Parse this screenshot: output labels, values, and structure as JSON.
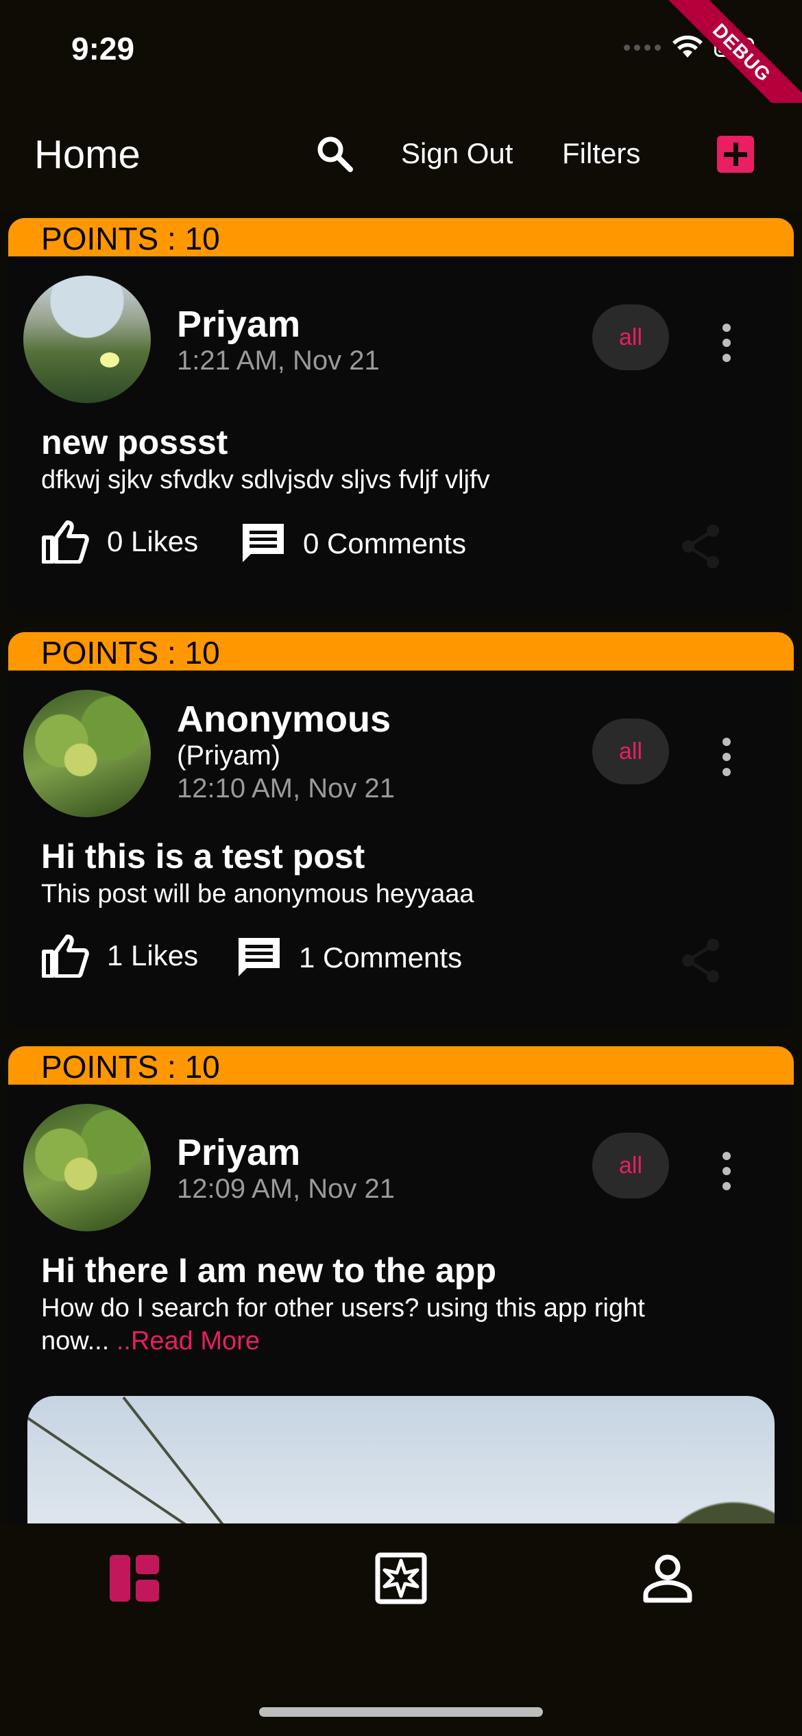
{
  "status_bar": {
    "time": "9:29",
    "debug_label": "DEBUG"
  },
  "app_bar": {
    "title": "Home",
    "sign_out_label": "Sign Out",
    "filters_label": "Filters",
    "icons": [
      "search-icon",
      "add-icon"
    ]
  },
  "colors": {
    "accent": "#e91e63",
    "points_banner": "#ff9800",
    "background": "#0d0b05",
    "card": "#0a0a0a"
  },
  "posts": [
    {
      "points": "POINTS : 10",
      "user_name": "Priyam",
      "user_sub": "",
      "time": "1:21 AM,  Nov 21",
      "chip": "all",
      "title": "new possst",
      "body": "dfkwj sjkv sfvdkv sdlvjsdv sljvs fvljf vljfv",
      "read_more": "",
      "likes": "0 Likes",
      "comments": "0 Comments"
    },
    {
      "points": "POINTS : 10",
      "user_name": "Anonymous",
      "user_sub": "(Priyam)",
      "time": "12:10 AM,  Nov 21",
      "chip": "all",
      "title": "Hi this is a test post",
      "body": "This post will be anonymous heyyaaa",
      "read_more": "",
      "likes": "1 Likes",
      "comments": "1 Comments"
    },
    {
      "points": "POINTS : 10",
      "user_name": "Priyam",
      "user_sub": "",
      "time": "12:09 AM,  Nov 21",
      "chip": "all",
      "title": "Hi there I am new to the app",
      "body": "How do I search for other users? using this app right now...",
      "read_more": " ..Read More",
      "likes": "",
      "comments": ""
    }
  ],
  "bottom_nav": {
    "items": [
      "dashboard-icon",
      "explore-icon",
      "profile-icon"
    ],
    "active": "dashboard-icon"
  }
}
